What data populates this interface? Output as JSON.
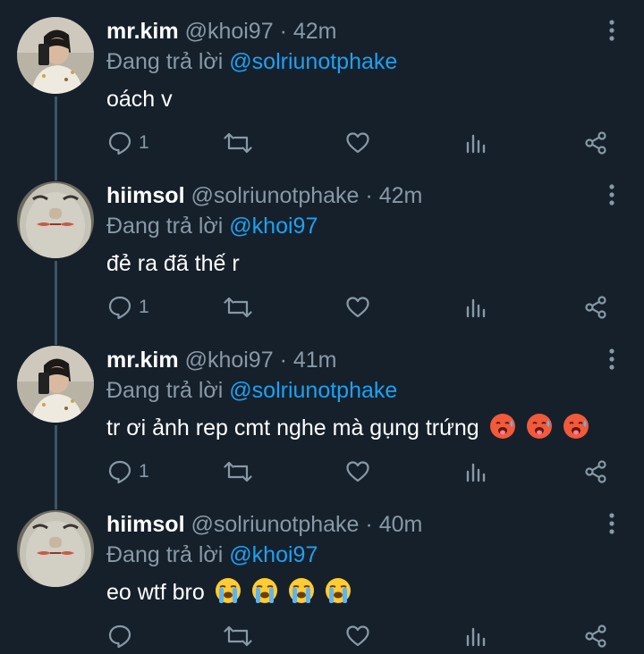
{
  "tweets": [
    {
      "name": "mr.kim",
      "handle": "@khoi97",
      "separator": "·",
      "time": "42m",
      "replying_prefix": "Đang trả lời",
      "replying_to": "@solriunotphake",
      "text": "oách v",
      "emojis": [],
      "reply_count": "1",
      "avatar_icon": "selfie-photo"
    },
    {
      "name": "hiimsol",
      "handle": "@solriunotphake",
      "separator": "·",
      "time": "42m",
      "replying_prefix": "Đang trả lời",
      "replying_to": "@khoi97",
      "text": "đẻ ra đã thế r",
      "emojis": [],
      "reply_count": "1",
      "avatar_icon": "face-mask-photo"
    },
    {
      "name": "mr.kim",
      "handle": "@khoi97",
      "separator": "·",
      "time": "41m",
      "replying_prefix": "Đang trả lời",
      "replying_to": "@solriunotphake",
      "text": "tr ơi ảnh rep cmt nghe mà gụng trứng",
      "emojis": [
        "hot-face-emoji",
        "hot-face-emoji",
        "hot-face-emoji"
      ],
      "reply_count": "1",
      "avatar_icon": "selfie-photo"
    },
    {
      "name": "hiimsol",
      "handle": "@solriunotphake",
      "separator": "·",
      "time": "40m",
      "replying_prefix": "Đang trả lời",
      "replying_to": "@khoi97",
      "text": "eo wtf bro",
      "emojis": [
        "loudly-crying-face-emoji",
        "loudly-crying-face-emoji",
        "loudly-crying-face-emoji",
        "loudly-crying-face-emoji"
      ],
      "reply_count": "",
      "avatar_icon": "face-mask-photo"
    }
  ],
  "colors": {
    "background": "#15202b",
    "secondary_text": "#8899a6",
    "mention": "#1da1f2",
    "thread_line": "#3d5466"
  }
}
